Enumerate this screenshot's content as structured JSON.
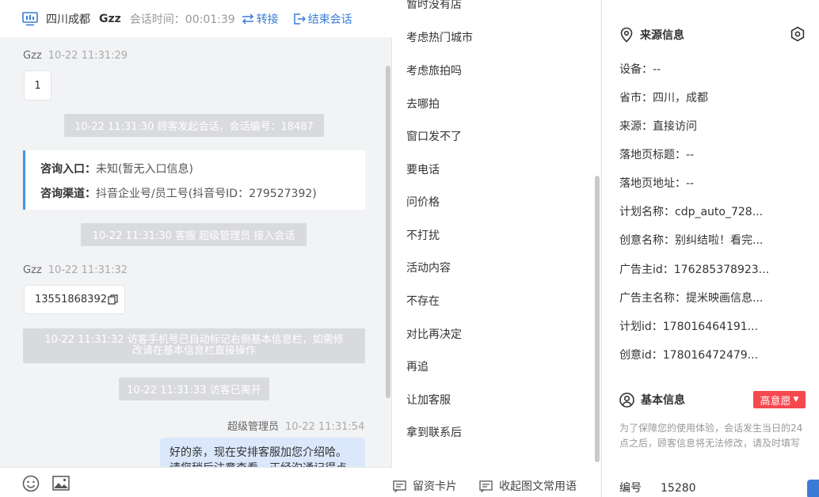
{
  "header": {
    "location": "四川成都",
    "nickname": "Gzz",
    "session_time_label": "会话时间：00:01:39",
    "transfer_label": "转接",
    "end_label": "结束会话"
  },
  "messages": {
    "m1_sender": "Gzz",
    "m1_time": "10-22 11:31:29",
    "m1_text": "1",
    "sys1": "10-22 11:31:30 顾客发起会话，会话编号：18487",
    "entry_label": "咨询入口：",
    "entry_value": "未知(暂无入口信息)",
    "channel_label": "咨询渠道：",
    "channel_value": "抖音企业号/员工号(抖音号ID：279527392)",
    "sys2": "10-22 11:31:30 客服 超级管理员 接入会话",
    "m2_sender": "Gzz",
    "m2_time": "10-22 11:31:32",
    "m2_text": "13551868392",
    "sys3_line1": "10-22 11:31:32 访客手机号已自动标记右侧基本信息栏，如需修",
    "sys3_line2": "改请在基本信息栏直接操作",
    "sys4": "10-22 11:31:33 访客已离开",
    "m3_sender": "超级管理员",
    "m3_time": "10-22 11:31:54",
    "m3_line1": "好的亲，现在安排客服加您介绍哈。",
    "m3_line2": "请您稍后注意查看，正经沟通记得点"
  },
  "phrases": [
    "暂时没有店",
    "考虑热门城市",
    "考虑旅拍吗",
    "去哪拍",
    "窗口发不了",
    "要电话",
    "问价格",
    "不打扰",
    "活动内容",
    "不存在",
    "对比再决定",
    "再追",
    "让加客服",
    "拿到联系后"
  ],
  "phrase_footer": {
    "card_label": "留资卡片",
    "collapse_label": "收起图文常用语"
  },
  "source_info": {
    "title": "来源信息",
    "rows": [
      "设备：--",
      "省市：四川，成都",
      "来源：直接访问",
      "落地页标题：--",
      "落地页地址：--",
      "计划名称：cdp_auto_728...",
      "创意名称：别纠结啦！看完...",
      "广告主id：176285378923...",
      "广告主名称：提米映画信息...",
      "计划id：178016464191...",
      "创意id：178016472479..."
    ]
  },
  "basic_info": {
    "title": "基本信息",
    "intent_tag": "高意愿",
    "note": "为了保障您的使用体验，会话发生当日的24点之后，顾客信息将无法修改，请及时填写",
    "id_label": "编号",
    "id_value": "15280"
  },
  "colors": {
    "accent": "#3a7bd5",
    "tag_red": "#f5484f",
    "sys_gray": "#d9dadd",
    "out_bubble": "#dbe8fc"
  }
}
